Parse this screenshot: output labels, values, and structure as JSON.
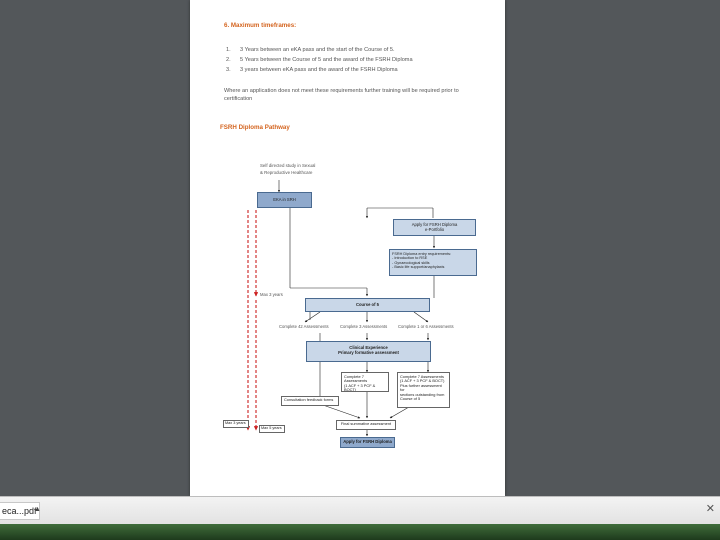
{
  "document": {
    "section_heading": "6.    Maximum timeframes:",
    "list": [
      {
        "num": "1.",
        "text": "3 Years between an eKA pass and the start of the Course of 5."
      },
      {
        "num": "2.",
        "text": "5 Years between the Course of 5 and the award of the FSRH Diploma"
      },
      {
        "num": "3.",
        "text": "3 years between eKA pass and the award of the FSRH Diploma"
      }
    ],
    "note_line1": "Where an application does not meet these requirements further training will be required prior to",
    "note_line2": "certification",
    "pathway_heading": "FSRH Diploma Pathway"
  },
  "flowchart": {
    "start_line1": "Self directed study in Sexual",
    "start_line2": "& Reproductive Healthcare",
    "eka": "EKA in SRH",
    "apply_line1": "Apply for FSRH Diploma",
    "apply_line2": "e-Portfolio",
    "reqs": [
      "FSRH Diploma entry requirements:",
      "- Introduction to RSE",
      "- Gynaecological skills",
      "- Basic life support/anaphylaxis"
    ],
    "max3_a": "Max 3 years",
    "course": "Course of 5",
    "branch_left": "Complete 42 Assessments",
    "branch_mid": "Complete 3 Assessments",
    "branch_right": "Complete 1 or 6 Assessments",
    "clin_line1": "Clinical Experience",
    "clin_line2": "Primary formative assessment",
    "assess_a": [
      "Complete 7 Assessments",
      "(1 ACF + 3 PCF & BOCT)"
    ],
    "assess_b": [
      "Complete 7 Assessments",
      "(1 ACF + 3 PCF & BOCT)",
      "Plus further assessment for",
      "sections outstanding from",
      "Course of 5"
    ],
    "consult": "Consultation feedback forms",
    "final": "Final summative assessment",
    "apply_final": "Apply for FSRH Diploma",
    "max3_b": "Max 3 years",
    "max5": "Max 5 years"
  },
  "downloads_bar": {
    "item_label": "eca...pdf",
    "chevron_icon": "chevron-up-icon",
    "close_icon": "close-icon"
  },
  "colors": {
    "viewer_bg": "#53575a",
    "heading_orange": "#d4641f",
    "box_blue": "#c9d7e8",
    "arrow_red": "#cc1f1f"
  }
}
